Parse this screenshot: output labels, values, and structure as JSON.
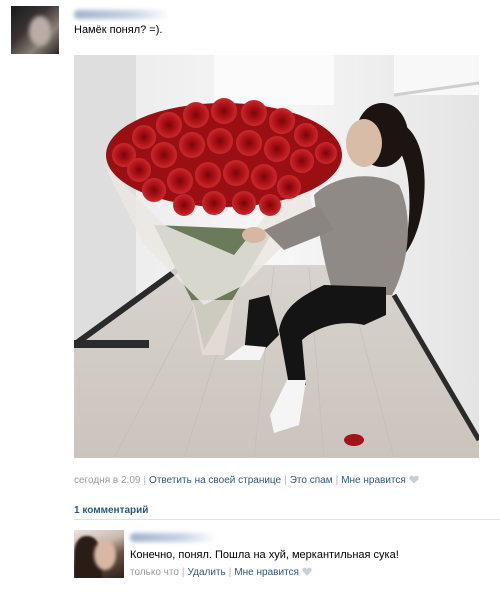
{
  "post": {
    "text": "Намёк понял? =).",
    "meta": {
      "time": "сегодня в 2:09",
      "reply_label": "Ответить на своей странице",
      "spam_label": "Это спам",
      "like_label": "Мне нравится"
    }
  },
  "comments": {
    "count_label": "1 комментарий",
    "items": [
      {
        "text": "Конечно, понял. Пошла на хуй, меркантильная сука!",
        "time": "только что",
        "delete_label": "Удалить",
        "like_label": "Мне нравится"
      }
    ]
  },
  "colors": {
    "link": "#2b587a",
    "meta": "#999999",
    "divider": "#dae1e8"
  },
  "icons": {
    "like": "heart-icon"
  }
}
